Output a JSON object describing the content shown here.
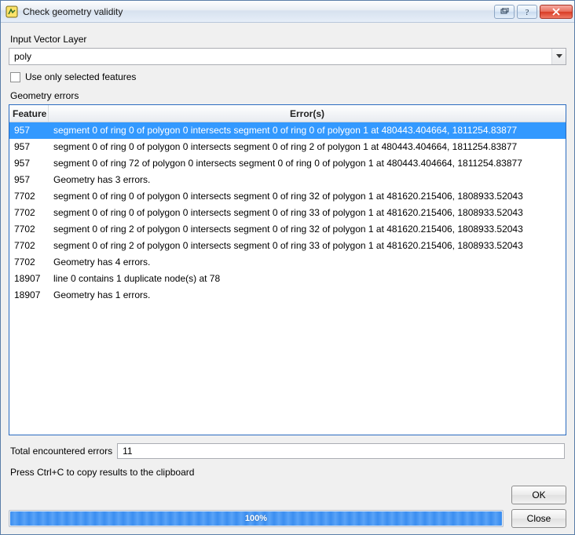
{
  "window": {
    "title": "Check geometry validity"
  },
  "titlebar_buttons": {
    "restore_tooltip": "Restore",
    "help_tooltip": "Help",
    "close_tooltip": "Close"
  },
  "input_layer": {
    "label": "Input Vector Layer",
    "value": "poly"
  },
  "selected_only": {
    "label": "Use only selected features",
    "checked": false
  },
  "errors_section_label": "Geometry errors",
  "table": {
    "headers": {
      "feature": "Feature",
      "errors": "Error(s)"
    },
    "rows": [
      {
        "feature": "957",
        "error": "segment 0 of ring 0 of polygon 0 intersects segment 0 of ring 0 of polygon 1 at 480443.404664, 1811254.83877",
        "selected": true
      },
      {
        "feature": "957",
        "error": "segment 0 of ring 0 of polygon 0 intersects segment 0 of ring 2 of polygon 1 at 480443.404664, 1811254.83877"
      },
      {
        "feature": "957",
        "error": "segment 0 of ring 72 of polygon 0 intersects segment 0 of ring 0 of polygon 1 at 480443.404664, 1811254.83877"
      },
      {
        "feature": "957",
        "error": "Geometry has 3 errors."
      },
      {
        "feature": "7702",
        "error": "segment 0 of ring 0 of polygon 0 intersects segment 0 of ring 32 of polygon 1 at 481620.215406, 1808933.52043"
      },
      {
        "feature": "7702",
        "error": "segment 0 of ring 0 of polygon 0 intersects segment 0 of ring 33 of polygon 1 at 481620.215406, 1808933.52043"
      },
      {
        "feature": "7702",
        "error": "segment 0 of ring 2 of polygon 0 intersects segment 0 of ring 32 of polygon 1 at 481620.215406, 1808933.52043"
      },
      {
        "feature": "7702",
        "error": "segment 0 of ring 2 of polygon 0 intersects segment 0 of ring 33 of polygon 1 at 481620.215406, 1808933.52043"
      },
      {
        "feature": "7702",
        "error": "Geometry has 4 errors."
      },
      {
        "feature": "18907",
        "error": "line 0 contains 1 duplicate node(s) at 78"
      },
      {
        "feature": "18907",
        "error": "Geometry has 1 errors."
      }
    ]
  },
  "totals": {
    "label": "Total encountered errors",
    "value": "11"
  },
  "hint": "Press Ctrl+C to copy results to the clipboard",
  "progress": {
    "percent_label": "100%",
    "percent": 100
  },
  "buttons": {
    "ok": "OK",
    "close": "Close"
  }
}
